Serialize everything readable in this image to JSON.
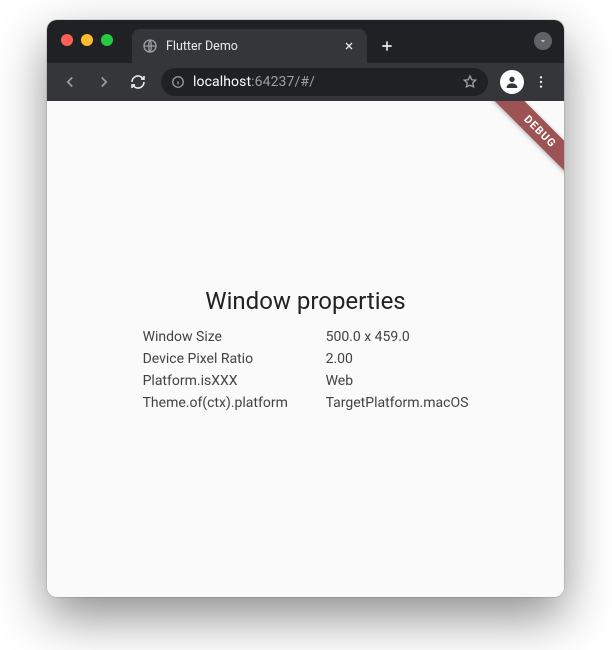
{
  "browser": {
    "tab_title": "Flutter Demo",
    "url": {
      "host": "localhost",
      "port_path": ":64237/#/"
    }
  },
  "page": {
    "debug_label": "DEBUG",
    "heading": "Window properties",
    "properties": [
      {
        "label": "Window Size",
        "value": "500.0 x 459.0"
      },
      {
        "label": "Device Pixel Ratio",
        "value": "2.00"
      },
      {
        "label": "Platform.isXXX",
        "value": "Web"
      },
      {
        "label": "Theme.of(ctx).platform",
        "value": "TargetPlatform.macOS"
      }
    ]
  }
}
